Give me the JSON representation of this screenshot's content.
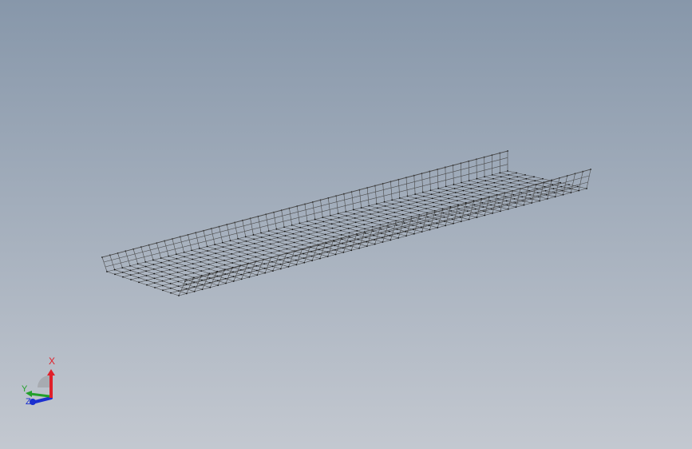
{
  "viewport": {
    "background_top": "#8797aa",
    "background_bottom": "#c3c8d0",
    "model": {
      "name": "wire-mesh-cable-tray",
      "wire_color": "#4a4a4a",
      "node_color": "#111111"
    }
  },
  "triad": {
    "x_label": "X",
    "y_label": "Y",
    "z_label": "Z",
    "x_color": "#e0202a",
    "y_color": "#22a02a",
    "z_color": "#1a2fd0",
    "sphere_color": "#a7abb1"
  }
}
